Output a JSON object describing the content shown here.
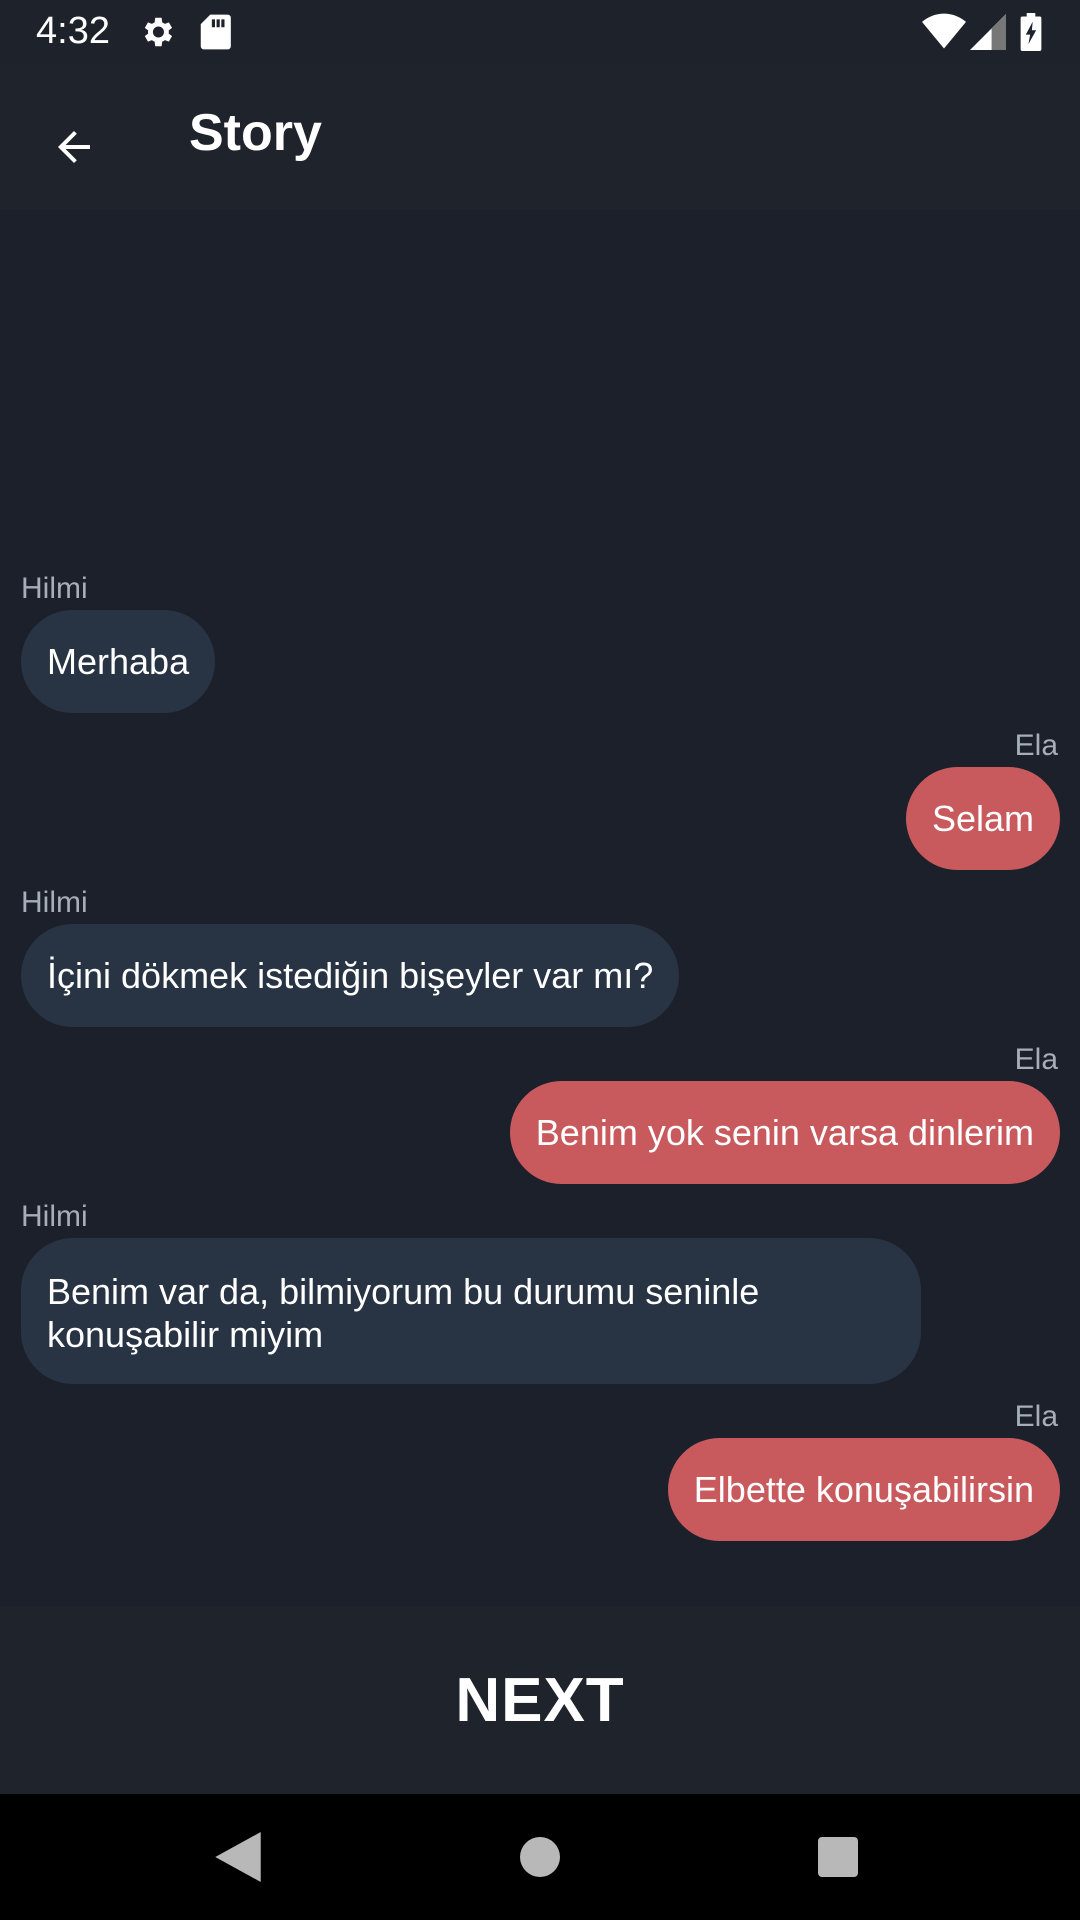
{
  "status_bar": {
    "time": "4:32",
    "icons": [
      "gear-icon",
      "sd-card-icon",
      "wifi-icon",
      "signal-icon",
      "battery-charging-icon"
    ]
  },
  "app_bar": {
    "title": "Story",
    "back_icon": "arrow-back-icon"
  },
  "messages": [
    {
      "sender": "Hilmi",
      "text": "Merhaba",
      "side": "left"
    },
    {
      "sender": "Ela",
      "text": "Selam",
      "side": "right"
    },
    {
      "sender": "Hilmi",
      "text": "İçini dökmek istediğin bişeyler var mı?",
      "side": "left"
    },
    {
      "sender": "Ela",
      "text": "Benim yok senin varsa dinlerim",
      "side": "right"
    },
    {
      "sender": "Hilmi",
      "text": "Benim var da, bilmiyorum bu durumu seninle konuşabilir miyim",
      "side": "left"
    },
    {
      "sender": "Ela",
      "text": "Elbette konuşabilirsin",
      "side": "right"
    }
  ],
  "next_button": {
    "label": "NEXT"
  },
  "nav_bar": {
    "icons": [
      "nav-back-icon",
      "nav-home-icon",
      "nav-recents-icon"
    ]
  },
  "colors": {
    "background": "#1b202b",
    "left_bubble": "#283443",
    "right_bubble": "#c85a5e",
    "sender_text": "#a7adb9"
  }
}
